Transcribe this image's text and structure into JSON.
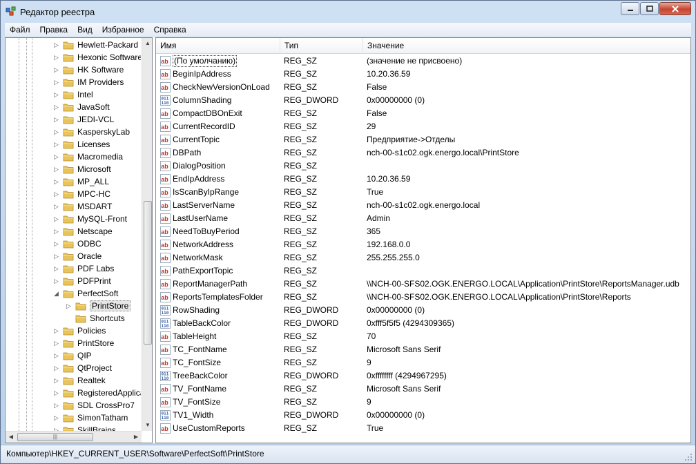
{
  "window": {
    "title": "Редактор реестра"
  },
  "menu": [
    "Файл",
    "Правка",
    "Вид",
    "Избранное",
    "Справка"
  ],
  "tree": {
    "items": [
      {
        "label": "Hewlett-Packard",
        "level": 2,
        "expander": "▷"
      },
      {
        "label": "Hexonic Software",
        "level": 2,
        "expander": "▷"
      },
      {
        "label": "HK Software",
        "level": 2,
        "expander": "▷"
      },
      {
        "label": "IM Providers",
        "level": 2,
        "expander": "▷"
      },
      {
        "label": "Intel",
        "level": 2,
        "expander": "▷"
      },
      {
        "label": "JavaSoft",
        "level": 2,
        "expander": "▷"
      },
      {
        "label": "JEDI-VCL",
        "level": 2,
        "expander": "▷"
      },
      {
        "label": "KasperskyLab",
        "level": 2,
        "expander": "▷"
      },
      {
        "label": "Licenses",
        "level": 2,
        "expander": "▷"
      },
      {
        "label": "Macromedia",
        "level": 2,
        "expander": "▷"
      },
      {
        "label": "Microsoft",
        "level": 2,
        "expander": "▷"
      },
      {
        "label": "MP_ALL",
        "level": 2,
        "expander": "▷"
      },
      {
        "label": "MPC-HC",
        "level": 2,
        "expander": "▷"
      },
      {
        "label": "MSDART",
        "level": 2,
        "expander": "▷"
      },
      {
        "label": "MySQL-Front",
        "level": 2,
        "expander": "▷"
      },
      {
        "label": "Netscape",
        "level": 2,
        "expander": "▷"
      },
      {
        "label": "ODBC",
        "level": 2,
        "expander": "▷"
      },
      {
        "label": "Oracle",
        "level": 2,
        "expander": "▷"
      },
      {
        "label": "PDF Labs",
        "level": 2,
        "expander": "▷"
      },
      {
        "label": "PDFPrint",
        "level": 2,
        "expander": "▷"
      },
      {
        "label": "PerfectSoft",
        "level": 2,
        "expander": "◢"
      },
      {
        "label": "PrintStore",
        "level": 3,
        "expander": "▷",
        "selected": true
      },
      {
        "label": "Shortcuts",
        "level": 3,
        "expander": ""
      },
      {
        "label": "Policies",
        "level": 2,
        "expander": "▷"
      },
      {
        "label": "PrintStore",
        "level": 2,
        "expander": "▷"
      },
      {
        "label": "QIP",
        "level": 2,
        "expander": "▷"
      },
      {
        "label": "QtProject",
        "level": 2,
        "expander": "▷"
      },
      {
        "label": "Realtek",
        "level": 2,
        "expander": "▷"
      },
      {
        "label": "RegisteredApplications",
        "level": 2,
        "expander": "▷"
      },
      {
        "label": "SDL CrossPro7",
        "level": 2,
        "expander": "▷"
      },
      {
        "label": "SimonTatham",
        "level": 2,
        "expander": "▷"
      },
      {
        "label": "SkillBrains",
        "level": 2,
        "expander": "▷"
      }
    ]
  },
  "list": {
    "columns": [
      "Имя",
      "Тип",
      "Значение"
    ],
    "rows": [
      {
        "name": "(По умолчанию)",
        "type": "REG_SZ",
        "value": "(значение не присвоено)",
        "kind": "sz",
        "focus": true
      },
      {
        "name": "BeginIpAddress",
        "type": "REG_SZ",
        "value": "10.20.36.59",
        "kind": "sz"
      },
      {
        "name": "CheckNewVersionOnLoad",
        "type": "REG_SZ",
        "value": "False",
        "kind": "sz"
      },
      {
        "name": "ColumnShading",
        "type": "REG_DWORD",
        "value": "0x00000000 (0)",
        "kind": "dword"
      },
      {
        "name": "CompactDBOnExit",
        "type": "REG_SZ",
        "value": "False",
        "kind": "sz"
      },
      {
        "name": "CurrentRecordID",
        "type": "REG_SZ",
        "value": "29",
        "kind": "sz"
      },
      {
        "name": "CurrentTopic",
        "type": "REG_SZ",
        "value": "Предприятие->Отделы",
        "kind": "sz"
      },
      {
        "name": "DBPath",
        "type": "REG_SZ",
        "value": "nch-00-s1c02.ogk.energo.local\\PrintStore",
        "kind": "sz"
      },
      {
        "name": "DialogPosition",
        "type": "REG_SZ",
        "value": "",
        "kind": "sz"
      },
      {
        "name": "EndIpAddress",
        "type": "REG_SZ",
        "value": "10.20.36.59",
        "kind": "sz"
      },
      {
        "name": "IsScanByIpRange",
        "type": "REG_SZ",
        "value": "True",
        "kind": "sz"
      },
      {
        "name": "LastServerName",
        "type": "REG_SZ",
        "value": "nch-00-s1c02.ogk.energo.local",
        "kind": "sz"
      },
      {
        "name": "LastUserName",
        "type": "REG_SZ",
        "value": "Admin",
        "kind": "sz"
      },
      {
        "name": "NeedToBuyPeriod",
        "type": "REG_SZ",
        "value": "365",
        "kind": "sz"
      },
      {
        "name": "NetworkAddress",
        "type": "REG_SZ",
        "value": "192.168.0.0",
        "kind": "sz"
      },
      {
        "name": "NetworkMask",
        "type": "REG_SZ",
        "value": "255.255.255.0",
        "kind": "sz"
      },
      {
        "name": "PathExportTopic",
        "type": "REG_SZ",
        "value": "",
        "kind": "sz"
      },
      {
        "name": "ReportManagerPath",
        "type": "REG_SZ",
        "value": "\\\\NCH-00-SFS02.OGK.ENERGO.LOCAL\\Application\\PrintStore\\ReportsManager.udb",
        "kind": "sz"
      },
      {
        "name": "ReportsTemplatesFolder",
        "type": "REG_SZ",
        "value": "\\\\NCH-00-SFS02.OGK.ENERGO.LOCAL\\Application\\PrintStore\\Reports",
        "kind": "sz"
      },
      {
        "name": "RowShading",
        "type": "REG_DWORD",
        "value": "0x00000000 (0)",
        "kind": "dword"
      },
      {
        "name": "TableBackColor",
        "type": "REG_DWORD",
        "value": "0xfff5f5f5 (4294309365)",
        "kind": "dword"
      },
      {
        "name": "TableHeight",
        "type": "REG_SZ",
        "value": "70",
        "kind": "sz"
      },
      {
        "name": "TC_FontName",
        "type": "REG_SZ",
        "value": "Microsoft Sans Serif",
        "kind": "sz"
      },
      {
        "name": "TC_FontSize",
        "type": "REG_SZ",
        "value": "9",
        "kind": "sz"
      },
      {
        "name": "TreeBackColor",
        "type": "REG_DWORD",
        "value": "0xffffffff (4294967295)",
        "kind": "dword"
      },
      {
        "name": "TV_FontName",
        "type": "REG_SZ",
        "value": "Microsoft Sans Serif",
        "kind": "sz"
      },
      {
        "name": "TV_FontSize",
        "type": "REG_SZ",
        "value": "9",
        "kind": "sz"
      },
      {
        "name": "TV1_Width",
        "type": "REG_DWORD",
        "value": "0x00000000 (0)",
        "kind": "dword"
      },
      {
        "name": "UseCustomReports",
        "type": "REG_SZ",
        "value": "True",
        "kind": "sz"
      }
    ]
  },
  "statusbar": {
    "path": "Компьютер\\HKEY_CURRENT_USER\\Software\\PerfectSoft\\PrintStore"
  },
  "colors": {
    "sz_icon": "#c0392b",
    "dword_icon": "#2e5aa8",
    "folder": "#e8c45a"
  },
  "icons": {
    "string_value": "reg-sz-icon",
    "dword_value": "reg-dword-icon",
    "folder": "folder-icon"
  }
}
